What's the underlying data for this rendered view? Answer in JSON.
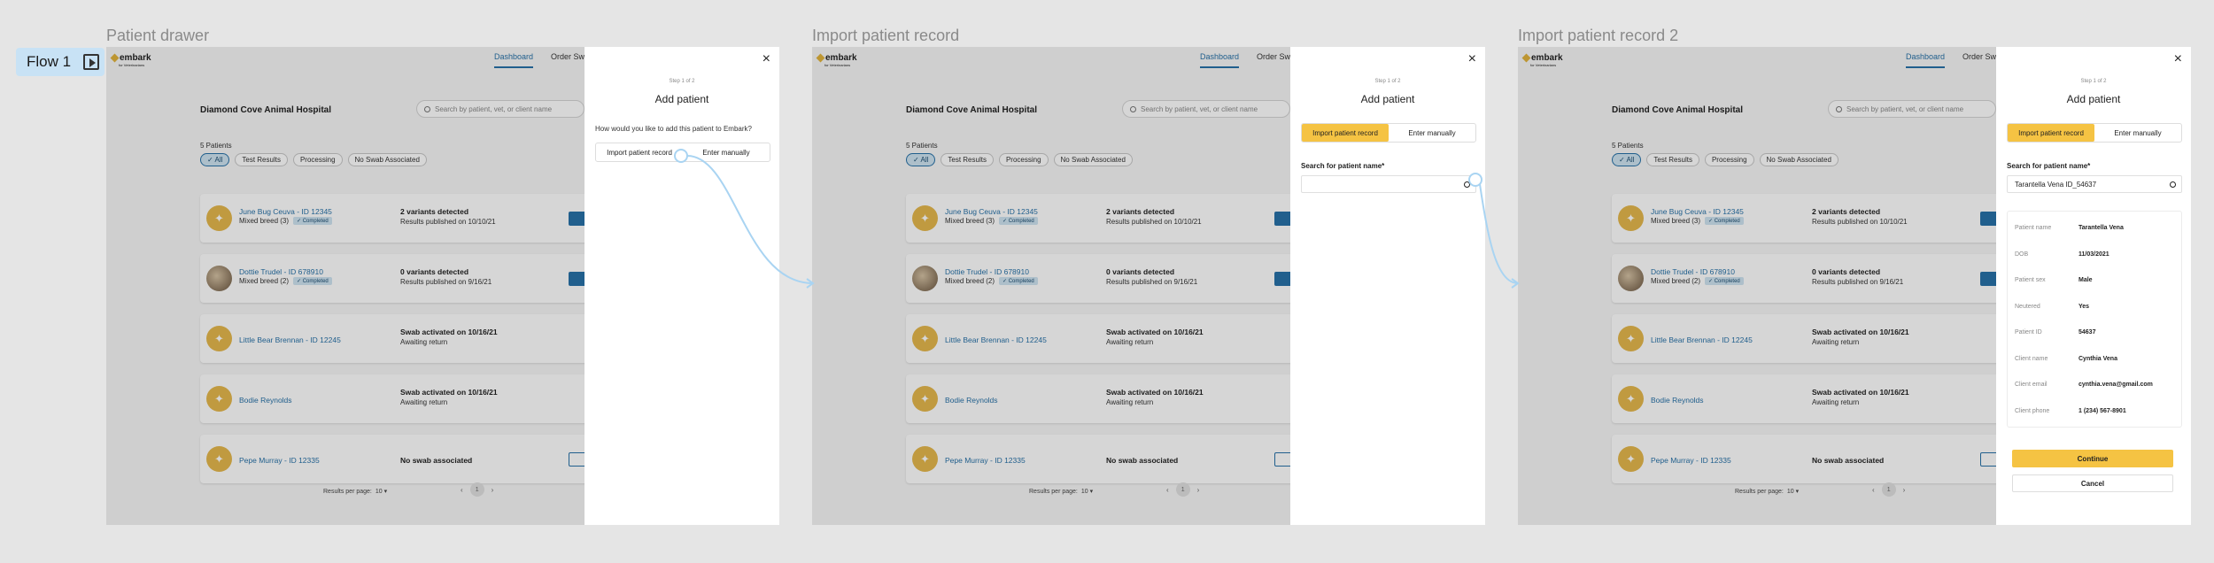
{
  "frames": [
    {
      "title": "Patient drawer"
    },
    {
      "title": "Import patient record"
    },
    {
      "title": "Import patient record 2"
    }
  ],
  "flow_label": "Flow 1",
  "app": {
    "logo": "embark",
    "logo_sub": "for Veterinarians",
    "nav": [
      "Dashboard",
      "Order Swabs"
    ],
    "hospital": "Diamond Cove Animal Hospital",
    "search_placeholder": "Search by patient, vet, or client name",
    "patient_count": "5 Patients",
    "filters": [
      "✓ All",
      "Test Results",
      "Processing",
      "No Swab Associated"
    ],
    "patients": [
      {
        "name": "June Bug Ceuva - ID 12345",
        "breed": "Mixed breed (3)",
        "badge": "✓ Completed",
        "status": "2 variants detected",
        "sub": "Results published on 10/10/21"
      },
      {
        "name": "Dottie Trudel - ID 678910",
        "breed": "Mixed breed (2)",
        "badge": "✓ Completed",
        "status": "0 variants detected",
        "sub": "Results published on 9/16/21"
      },
      {
        "name": "Little Bear Brennan - ID 12245",
        "breed": "",
        "badge": "",
        "status": "Swab activated on 10/16/21",
        "sub": "Awaiting return"
      },
      {
        "name": "Bodie Reynolds",
        "breed": "",
        "badge": "",
        "status": "Swab activated on 10/16/21",
        "sub": "Awaiting return"
      },
      {
        "name": "Pepe Murray - ID 12335",
        "breed": "",
        "badge": "",
        "status": "No swab associated",
        "sub": ""
      }
    ],
    "results_per_page_label": "Results per page:",
    "results_per_page_value": "10 ▾",
    "page_prev": "‹",
    "page_current": "1",
    "page_next": "›"
  },
  "drawer": {
    "step": "Step 1 of 2",
    "title": "Add patient",
    "close": "×",
    "question": "How would you like to add this patient to Embark?",
    "option_import": "Import patient record",
    "option_manual": "Enter manually",
    "search_label": "Search for patient name*",
    "search_value": "Tarantella Vena  ID_54637",
    "details": [
      {
        "k": "Patient name",
        "v": "Tarantella Vena"
      },
      {
        "k": "DOB",
        "v": "11/03/2021"
      },
      {
        "k": "Patient sex",
        "v": "Male"
      },
      {
        "k": "Neutered",
        "v": "Yes"
      },
      {
        "k": "Patient ID",
        "v": "54637"
      },
      {
        "k": "Client name",
        "v": "Cynthia Vena"
      },
      {
        "k": "Client email",
        "v": "cynthia.vena@gmail.com"
      },
      {
        "k": "Client phone",
        "v": "1 (234) 567-8901"
      }
    ],
    "continue": "Continue",
    "cancel": "Cancel"
  },
  "colors": {
    "accent": "#2872a8",
    "yellow": "#f5c343",
    "connector": "#a9d4f2"
  }
}
